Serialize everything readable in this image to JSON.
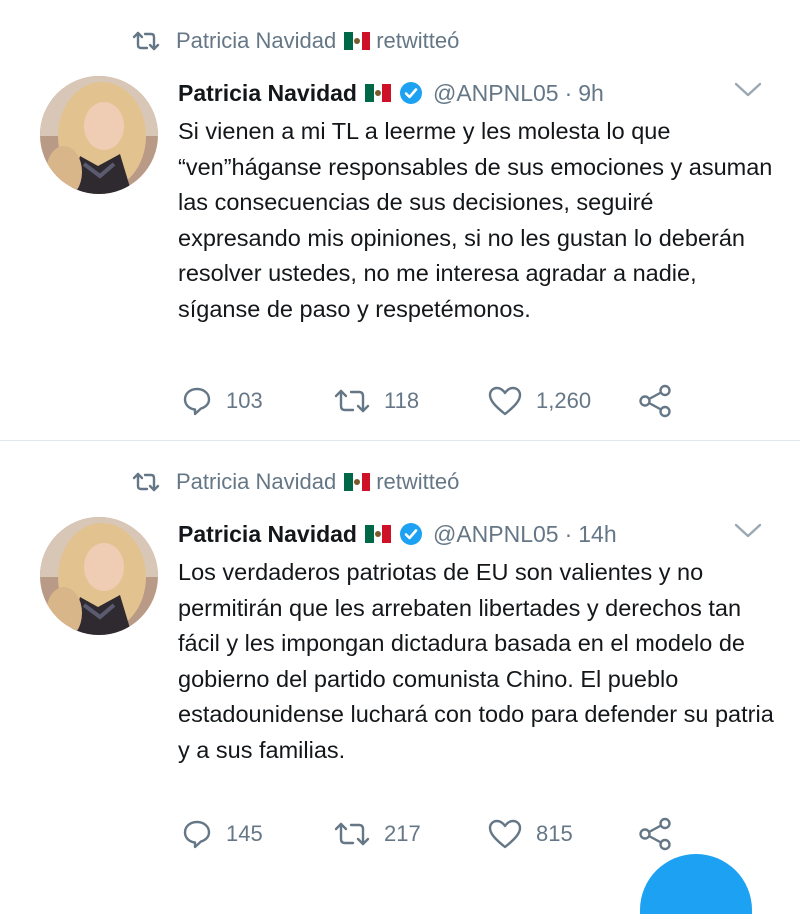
{
  "tweets": [
    {
      "retweet_banner": {
        "icon": "retweet-icon",
        "user": "Patricia Navidad",
        "flag": "mexico-flag-emoji",
        "action": "retwitteó"
      },
      "author": {
        "name": "Patricia Navidad",
        "flag": "mexico-flag-emoji",
        "verified": true,
        "handle": "@ANPNL05",
        "separator": "·",
        "time": "9h"
      },
      "text": "Si vienen a mi TL a leerme y les molesta lo que “ven”háganse responsables de sus emociones y asuman las consecuencias de sus decisiones, seguiré expresando mis opiniones, si no les gustan lo deberán resolver ustedes, no me interesa agradar a nadie, síganse de paso y respetémonos.",
      "actions": {
        "replies": "103",
        "retweets": "118",
        "likes": "1,260"
      }
    },
    {
      "retweet_banner": {
        "icon": "retweet-icon",
        "user": "Patricia Navidad",
        "flag": "mexico-flag-emoji",
        "action": "retwitteó"
      },
      "author": {
        "name": "Patricia Navidad",
        "flag": "mexico-flag-emoji",
        "verified": true,
        "handle": "@ANPNL05",
        "separator": "·",
        "time": "14h"
      },
      "text": "Los verdaderos patriotas de EU son valientes y no permitirán que les arrebaten libertades y derechos tan fácil y les impongan dictadura basada en el modelo de gobierno del partido comunista Chino. El pueblo estadounidense luchará con todo para defender su patria y a sus familias.",
      "actions": {
        "replies": "145",
        "retweets": "217",
        "likes": "815"
      }
    }
  ],
  "colors": {
    "text": "#14171a",
    "muted": "#657786",
    "accent": "#1da1f2",
    "divider": "#e1e8ed"
  }
}
